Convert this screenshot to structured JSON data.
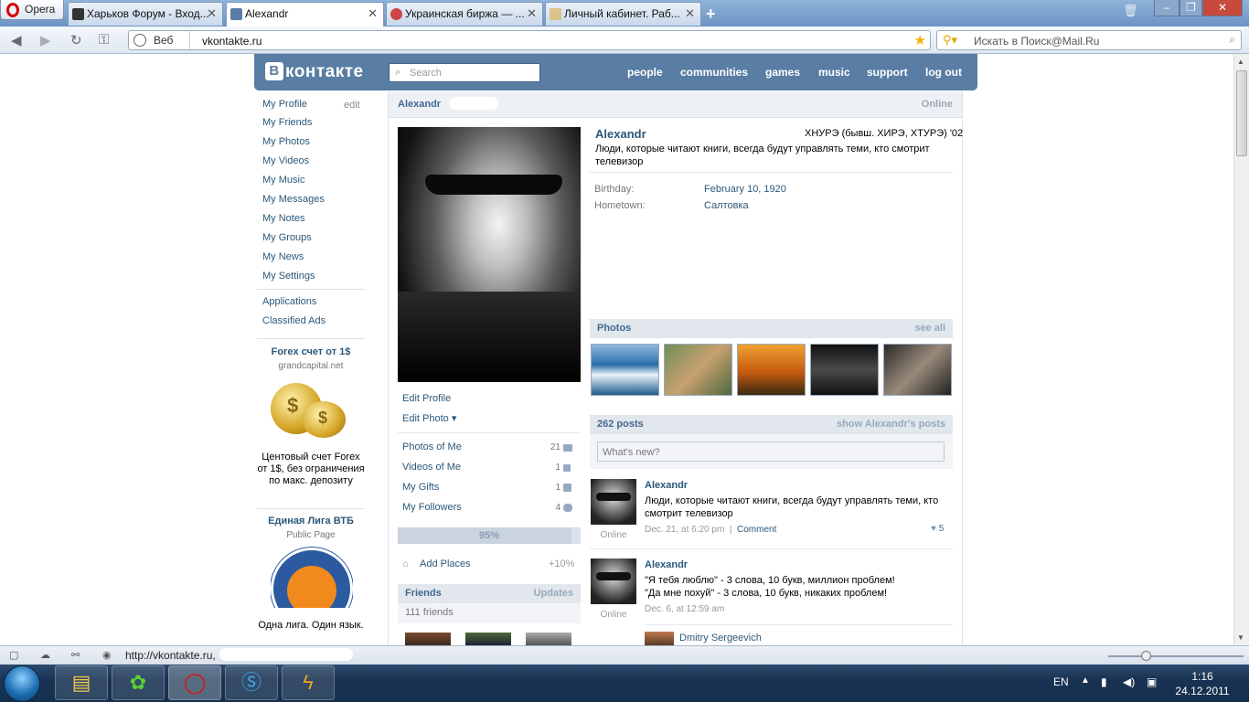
{
  "browser": {
    "menu_label": "Opera",
    "tabs": [
      {
        "title": "Харьков Форум - Вход...",
        "active": false
      },
      {
        "title": "Alexandr",
        "active": true
      },
      {
        "title": "Украинская биржа — ...",
        "active": false
      },
      {
        "title": "Личный кабинет. Раб...",
        "active": false
      }
    ],
    "address_prefix": "Веб",
    "url": "vkontakte.ru",
    "search_placeholder": "Искать в Поиск@Mail.Ru",
    "status_url": "http://vkontakte.ru,"
  },
  "vk": {
    "logo": "контакте",
    "logo_letter": "В",
    "search_placeholder": "Search",
    "nav": [
      "people",
      "communities",
      "games",
      "music",
      "support",
      "log out"
    ],
    "left_menu": [
      "My Profile",
      "My Friends",
      "My Photos",
      "My Videos",
      "My Music",
      "My Messages",
      "My Notes",
      "My Groups",
      "My News",
      "My Settings"
    ],
    "left_menu_edit": "edit",
    "left_menu_extra": [
      "Applications",
      "Classified Ads"
    ],
    "ads": [
      {
        "title": "Forex счет от 1$",
        "sub": "grandcapital.net",
        "text": "Центовый счет Forex от 1$, без ограничения по макс. депозиту"
      },
      {
        "title": "Единая Лига ВТБ",
        "sub": "Public Page",
        "text": "Одна лига. Один язык."
      }
    ]
  },
  "profile": {
    "bar_name": "Alexandr",
    "bar_status": "Online",
    "name": "Alexandr",
    "education": "ХНУРЭ (бывш. ХИРЭ, ХТУРЭ) '02",
    "status_text": "Люди, которые читают книги, всегда будут управлять теми, кто смотрит телевизор",
    "info": [
      {
        "label": "Birthday:",
        "value": "February 10, 1920"
      },
      {
        "label": "Hometown:",
        "value": "Салтовка"
      }
    ],
    "edit_profile": "Edit Profile",
    "edit_photo": "Edit Photo",
    "lists": [
      {
        "label": "Photos of Me",
        "count": "21"
      },
      {
        "label": "Videos of Me",
        "count": "1"
      },
      {
        "label": "My Gifts",
        "count": "1"
      },
      {
        "label": "My Followers",
        "count": "4"
      }
    ],
    "rating": "95%",
    "rating_value": 0.95,
    "add_places": "Add Places",
    "add_places_bonus": "+10%",
    "friends_title": "Friends",
    "friends_updates": "Updates",
    "friends_count": "111 friends",
    "photos_title": "Photos",
    "photos_see_all": "see all",
    "posts_title": "262 posts",
    "posts_show": "show Alexandr's posts",
    "whats_new": "What's new?",
    "posts": [
      {
        "author": "Alexandr",
        "text": "Люди, которые читают книги, всегда будут управлять теми, кто смотрит телевизор",
        "date": "Dec. 21, at 6:20 pm",
        "comment": "Comment",
        "likes": "5",
        "online": "Online"
      },
      {
        "author": "Alexandr",
        "text_lines": [
          "\"Я тебя люблю\" - 3 слова, 10 букв, миллион проблем!",
          "\"Да мне похуй\" - 3 слова, 10 букв, никаких проблем!"
        ],
        "date": "Dec. 6, at 12:59 am",
        "online": "Online"
      }
    ],
    "reply_author": "Dmitry Sergeevich"
  },
  "system": {
    "lang": "EN",
    "time": "1:16",
    "date": "24.12.2011"
  }
}
